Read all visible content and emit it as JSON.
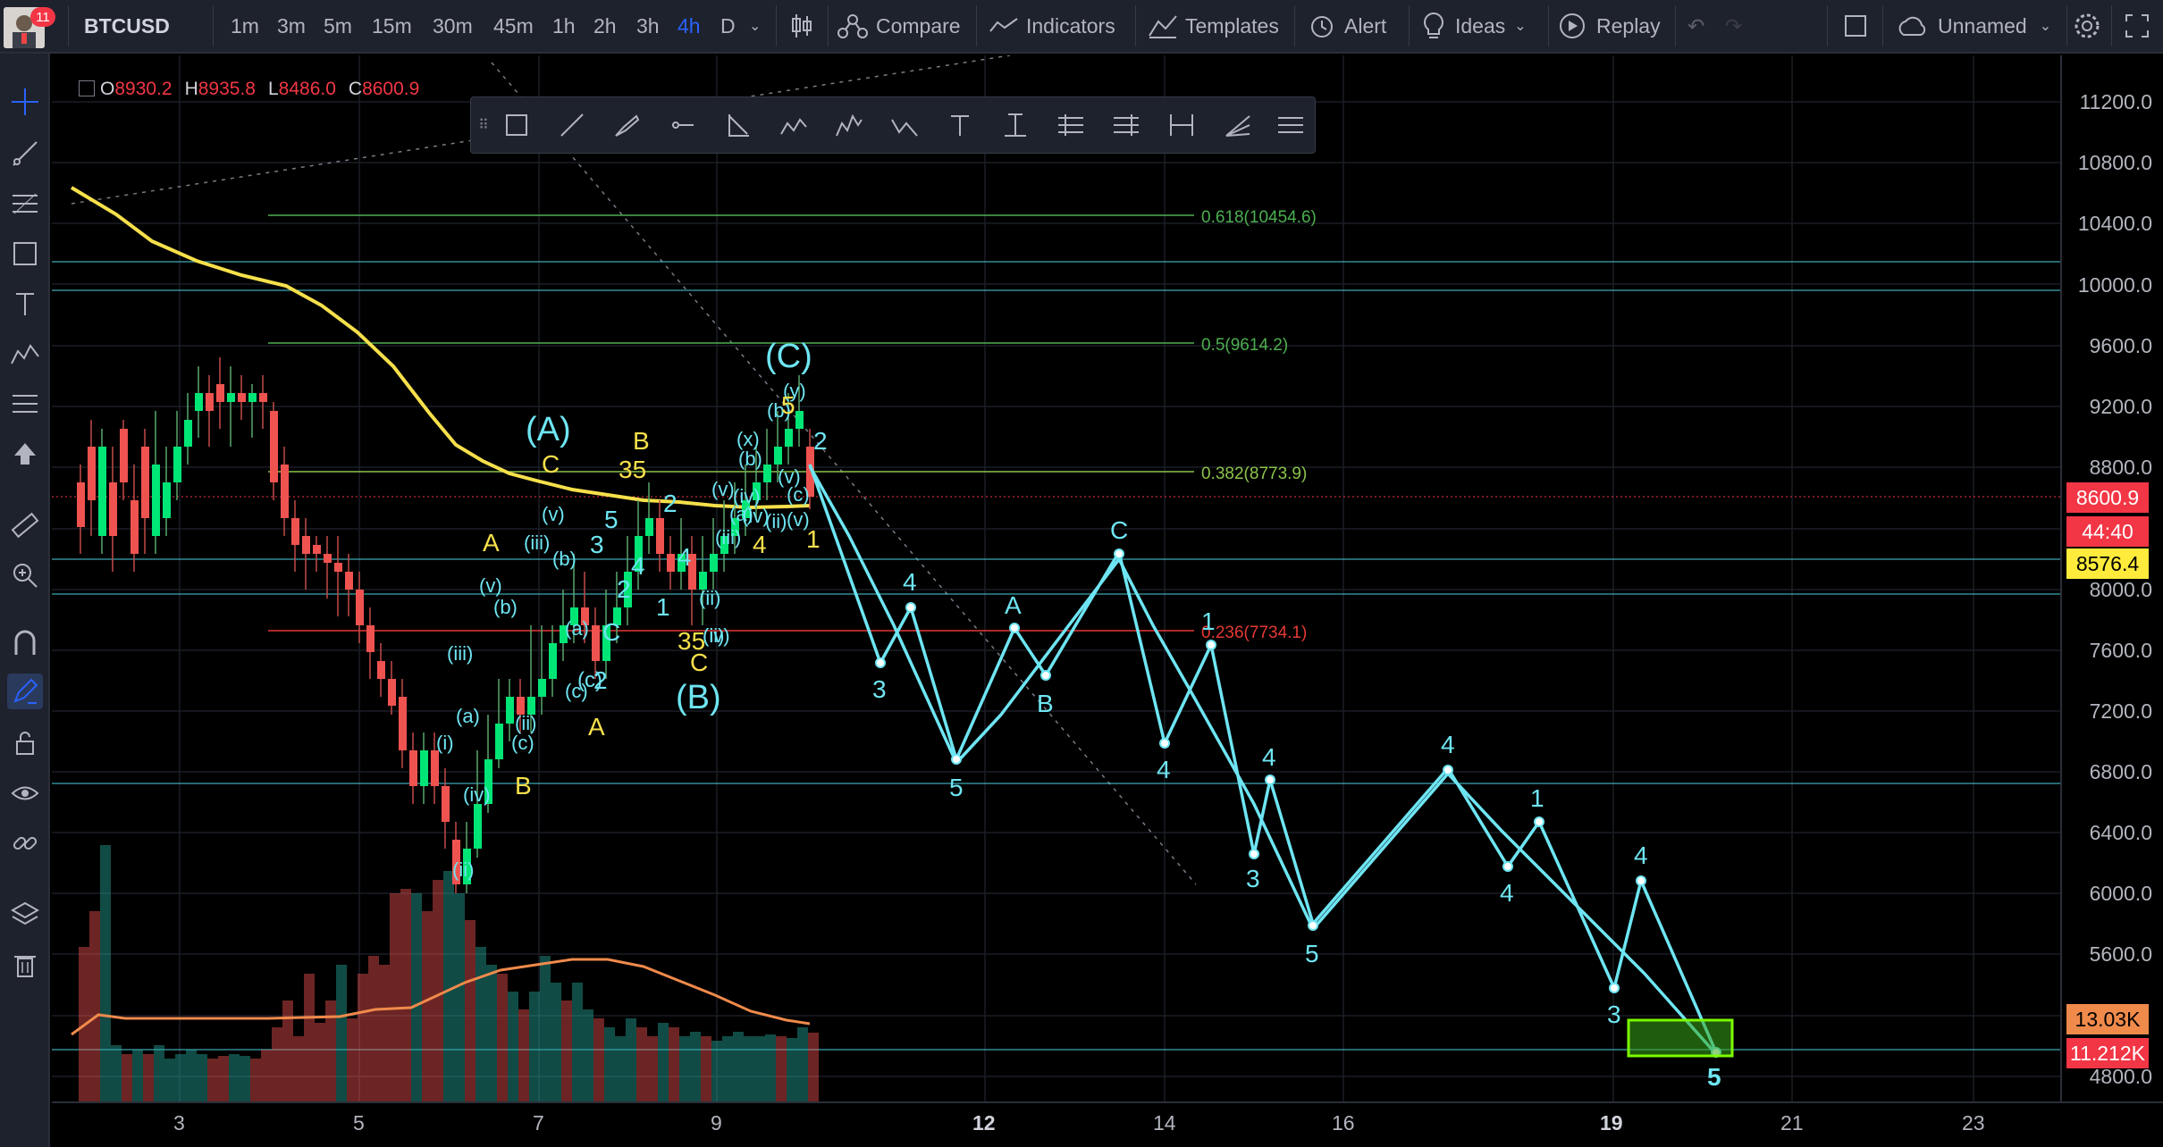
{
  "header": {
    "symbol": "BTCUSD",
    "notification_count": "11",
    "intervals": [
      "1m",
      "3m",
      "5m",
      "15m",
      "30m",
      "45m",
      "1h",
      "2h",
      "3h",
      "4h",
      "D"
    ],
    "active_interval": "4h",
    "compare_label": "Compare",
    "indicators_label": "Indicators",
    "templates_label": "Templates",
    "alert_label": "Alert",
    "ideas_label": "Ideas",
    "replay_label": "Replay",
    "layout_name": "Unnamed"
  },
  "ohlc": {
    "open_key": "O",
    "open": "8930.2",
    "high_key": "H",
    "high": "8935.8",
    "low_key": "L",
    "low": "8486.0",
    "close_key": "C",
    "close": "8600.9"
  },
  "fib_levels": [
    {
      "label": "0.618(10454.6)",
      "color": "#4caf50"
    },
    {
      "label": "0.5(9614.2)",
      "color": "#4caf50"
    },
    {
      "label": "0.382(8773.9)",
      "color": "#8bc34a"
    },
    {
      "label": "0.236(7734.1)",
      "color": "#e53935"
    }
  ],
  "price_axis": [
    "11200.0",
    "10800.0",
    "10400.0",
    "10000.0",
    "9600.0",
    "9200.0",
    "8800.0",
    "8000.0",
    "7600.0",
    "7200.0",
    "6800.0",
    "6400.0",
    "6000.0",
    "5600.0",
    "4800.0"
  ],
  "price_tags": {
    "last_price": "8600.9",
    "countdown": "44:40",
    "crosshair_price": "8576.4",
    "volume_ma": "13.03K",
    "volume": "11.212K"
  },
  "time_axis": [
    "3",
    "5",
    "7",
    "9",
    "12",
    "14",
    "16",
    "19",
    "21",
    "23"
  ],
  "wave_labels": {
    "cyan": [
      "(A)",
      "(B)",
      "(C)",
      "4",
      "3",
      "5",
      "A",
      "B",
      "C",
      "2",
      "1",
      "2",
      "4",
      "3",
      "5",
      "4",
      "1",
      "2",
      "3",
      "4",
      "5",
      "(i)",
      "(ii)",
      "(iii)",
      "(iv)",
      "(v)",
      "(a)",
      "(b)",
      "(c)",
      "(x)",
      "(y)"
    ],
    "yellow": [
      "A",
      "B",
      "C",
      "A",
      "B",
      "C",
      "35",
      "4",
      "5"
    ],
    "white": [
      "1",
      "2",
      "3",
      "4",
      "5"
    ]
  },
  "colors": {
    "up_candle": "#26a69a",
    "up_candle_bright": "#00e676",
    "down_candle": "#ef5350",
    "projection": "#6ee5f2",
    "moving_average": "#f6e04b",
    "volume_ma": "#f08a4b",
    "horizontal_line": "#4dd0e1",
    "target_box": "#7cfc00"
  }
}
